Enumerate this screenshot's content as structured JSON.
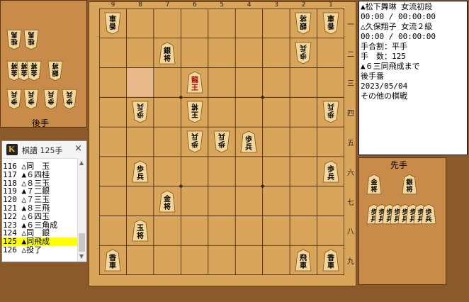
{
  "board": {
    "file_labels": [
      "9",
      "8",
      "7",
      "6",
      "5",
      "4",
      "3",
      "2",
      "1"
    ],
    "rank_labels": [
      "一",
      "二",
      "三",
      "四",
      "五",
      "六",
      "七",
      "八",
      "九"
    ],
    "highlight": {
      "file": 8,
      "rank": 3
    },
    "pieces": [
      {
        "file": 9,
        "rank": 1,
        "kanji": "香車",
        "side": "gote",
        "promoted": false
      },
      {
        "file": 2,
        "rank": 1,
        "kanji": "銀将",
        "side": "gote",
        "promoted": false
      },
      {
        "file": 1,
        "rank": 1,
        "kanji": "香車",
        "side": "gote",
        "promoted": false
      },
      {
        "file": 7,
        "rank": 2,
        "kanji": "銀将",
        "side": "sente",
        "promoted": false
      },
      {
        "file": 2,
        "rank": 2,
        "kanji": "歩兵",
        "side": "gote",
        "promoted": false
      },
      {
        "file": 6,
        "rank": 3,
        "kanji": "龍王",
        "side": "sente",
        "promoted": true
      },
      {
        "file": 8,
        "rank": 4,
        "kanji": "歩兵",
        "side": "gote",
        "promoted": false
      },
      {
        "file": 6,
        "rank": 4,
        "kanji": "王将",
        "side": "gote",
        "promoted": false
      },
      {
        "file": 1,
        "rank": 4,
        "kanji": "歩兵",
        "side": "gote",
        "promoted": false
      },
      {
        "file": 6,
        "rank": 5,
        "kanji": "歩兵",
        "side": "gote",
        "promoted": false
      },
      {
        "file": 5,
        "rank": 5,
        "kanji": "歩兵",
        "side": "gote",
        "promoted": false
      },
      {
        "file": 4,
        "rank": 5,
        "kanji": "歩兵",
        "side": "sente",
        "promoted": false
      },
      {
        "file": 8,
        "rank": 6,
        "kanji": "歩兵",
        "side": "sente",
        "promoted": false
      },
      {
        "file": 1,
        "rank": 6,
        "kanji": "歩兵",
        "side": "sente",
        "promoted": false
      },
      {
        "file": 7,
        "rank": 7,
        "kanji": "金将",
        "side": "sente",
        "promoted": false
      },
      {
        "file": 8,
        "rank": 8,
        "kanji": "玉将",
        "side": "sente",
        "promoted": false
      },
      {
        "file": 9,
        "rank": 9,
        "kanji": "香車",
        "side": "sente",
        "promoted": false
      },
      {
        "file": 2,
        "rank": 9,
        "kanji": "飛車",
        "side": "sente",
        "promoted": false
      },
      {
        "file": 1,
        "rank": 9,
        "kanji": "香車",
        "side": "sente",
        "promoted": false
      }
    ]
  },
  "gote_stand": {
    "label": "後手",
    "pieces": [
      {
        "kanji": "桂馬",
        "slot": 0
      },
      {
        "kanji": "桂馬",
        "slot": 1
      },
      {
        "kanji": "金将",
        "slot": 2
      },
      {
        "kanji": "金将",
        "slot": 3
      },
      {
        "kanji": "金将",
        "slot": 4
      },
      {
        "kanji": "銀将",
        "slot": 5
      },
      {
        "kanji": "歩兵",
        "slot": 6
      },
      {
        "kanji": "歩兵",
        "slot": 7
      },
      {
        "kanji": "歩兵",
        "slot": 8
      },
      {
        "kanji": "歩兵",
        "slot": 9
      }
    ]
  },
  "sente_stand": {
    "label": "先手",
    "pieces": [
      {
        "kanji": "金将",
        "slot": 0
      },
      {
        "kanji": "銀将",
        "slot": 1
      },
      {
        "kanji": "歩兵",
        "slot": 2
      },
      {
        "kanji": "歩兵",
        "slot": 3
      },
      {
        "kanji": "歩兵",
        "slot": 4
      },
      {
        "kanji": "歩兵",
        "slot": 5
      },
      {
        "kanji": "歩兵",
        "slot": 6
      },
      {
        "kanji": "歩兵",
        "slot": 7
      },
      {
        "kanji": "歩兵",
        "slot": 8
      },
      {
        "kanji": "歩兵",
        "slot": 9
      }
    ]
  },
  "info": {
    "lines": [
      "▲松下舞琳 女流初段",
      "00:00 / 00:00:00",
      "△久保翔子 女流２級",
      "00:00 / 00:00:00",
      "手合割：平手",
      "手　数：125",
      "▲６三同飛成まで",
      "後手番",
      "2023/05/04",
      "その他の棋戦"
    ]
  },
  "kifu": {
    "logo": "K",
    "title": "棋譜 125手",
    "close": "×",
    "scroll_up": "▲",
    "scroll_down": "▼",
    "selected_index": 9,
    "moves": [
      "116 △同　玉",
      "117 ▲６四桂",
      "118 △８三玉",
      "119 ▲７二銀",
      "120 △７三玉",
      "121 ▲８三飛",
      "122 △６四玉",
      "123 ▲６三角成",
      "124 △同　銀",
      "125 ▲同飛成",
      "126 △投了"
    ]
  }
}
